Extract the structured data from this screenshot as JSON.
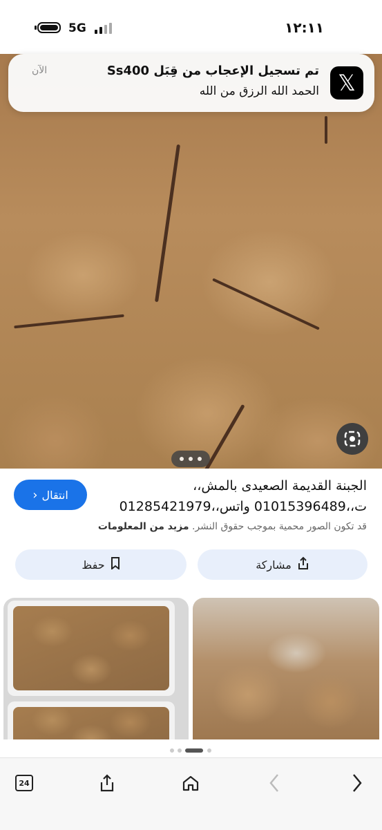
{
  "status_bar": {
    "time": "١٢:١١",
    "network": "5G"
  },
  "notification": {
    "app_icon": "x-logo",
    "logo_text": "𝕏",
    "title": "تم تسجيل الإعجاب من قِبَل Ss400",
    "body": "الحمد الله الرزق من الله",
    "time": "الآن"
  },
  "image_overlay": {
    "lens_icon": "google-lens-icon",
    "more_icon": "more-dots-icon"
  },
  "info": {
    "title_line1": "الجبنة القديمة الصعيدى بالمش،،",
    "title_line2": "ت،،01015396489 واتس،،01285421979",
    "copyright_text": "قد تكون الصور محمية بموجب حقوق النشر.",
    "more_info": "مزيد من المعلومات",
    "go_button": "انتقال",
    "go_icon": "chevron-left-icon"
  },
  "actions": {
    "share_label": "مشاركة",
    "share_icon": "share-icon",
    "save_label": "حفظ",
    "save_icon": "bookmark-icon"
  },
  "toolbar": {
    "tab_count": "24",
    "icons": [
      "tabs-icon",
      "share-icon",
      "home-icon",
      "back-icon",
      "forward-icon"
    ]
  },
  "colors": {
    "accent": "#1a73e8",
    "pill_bg": "#e8effb"
  }
}
